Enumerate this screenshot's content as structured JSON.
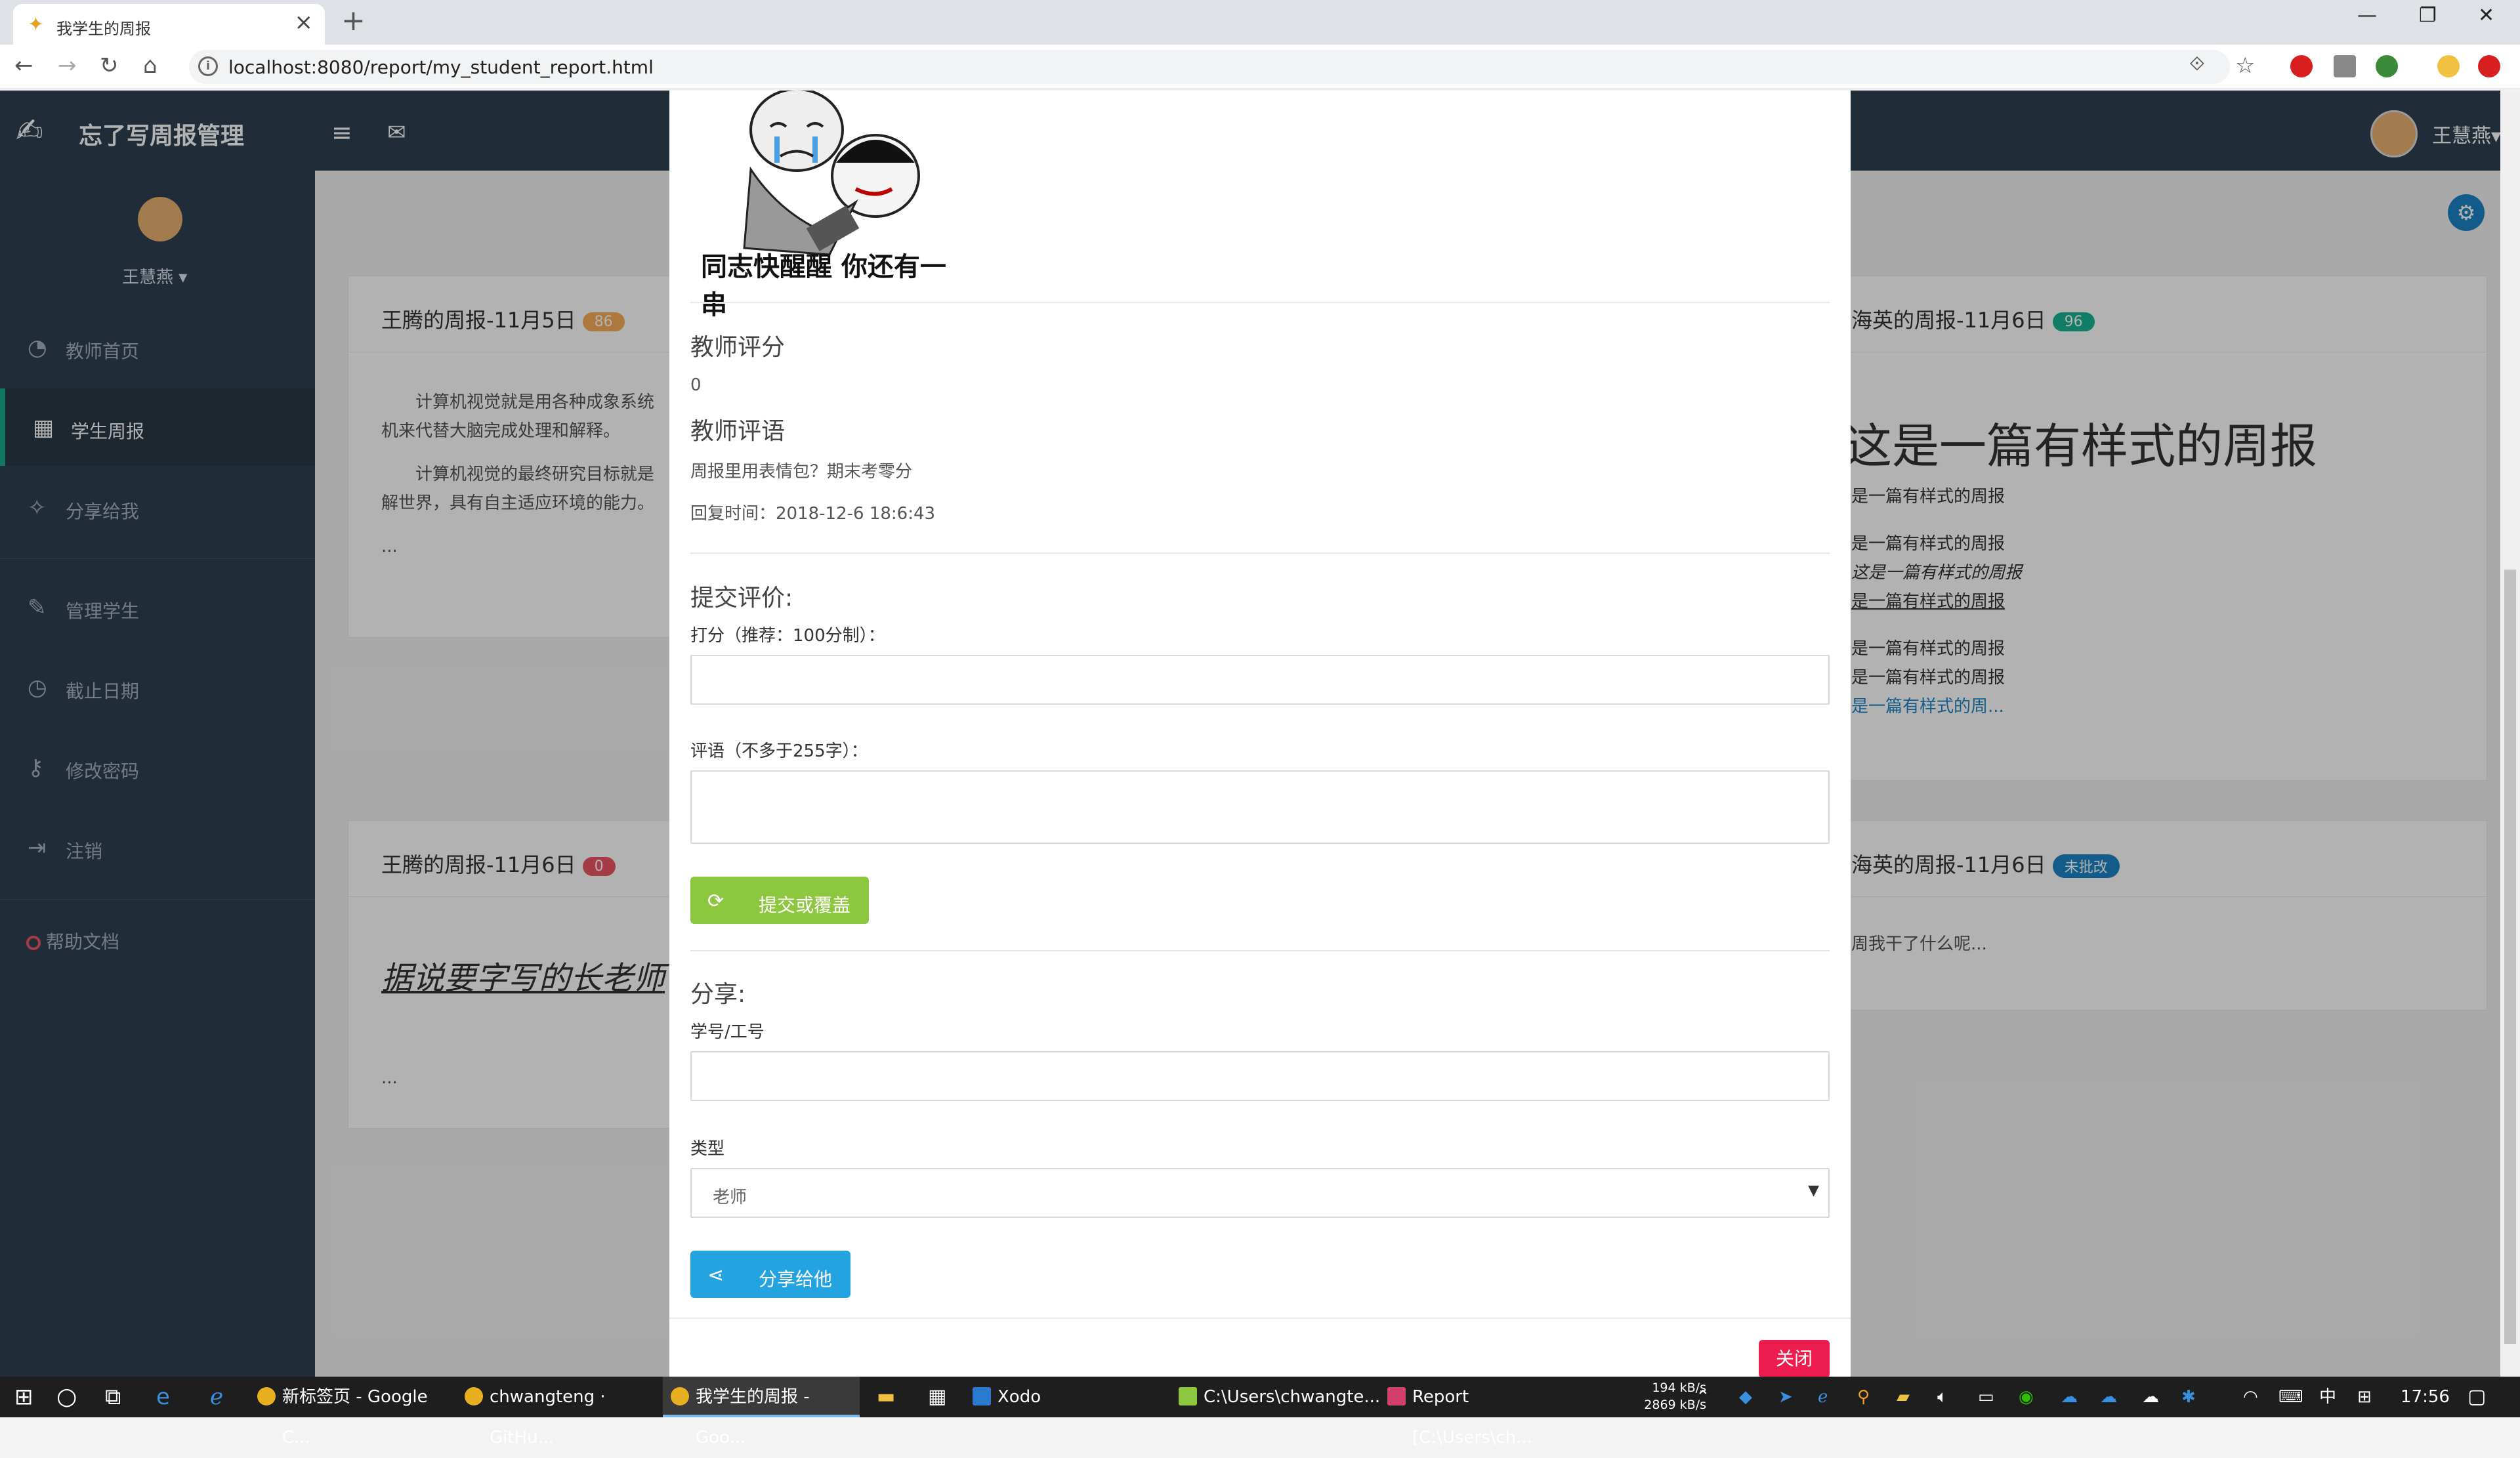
{
  "browser": {
    "tab_title": "我学生的周报",
    "url": "localhost:8080/report/my_student_report.html"
  },
  "app": {
    "brand": "忘了写周报管理",
    "user": "王慧燕",
    "sidebar": {
      "items": [
        {
          "label": "教师首页",
          "icon": "dashboard-icon"
        },
        {
          "label": "学生周报",
          "icon": "calendar-icon",
          "active": true
        },
        {
          "label": "分享给我",
          "icon": "share-icon"
        },
        {
          "label": "管理学生",
          "icon": "user-manage-icon"
        },
        {
          "label": "截止日期",
          "icon": "clock-icon"
        },
        {
          "label": "修改密码",
          "icon": "key-icon"
        },
        {
          "label": "注销",
          "icon": "logout-icon"
        }
      ],
      "help": "帮助文档"
    },
    "cards": [
      {
        "title": "王腾的周报-11月5日",
        "badge": "86",
        "badge_color": "#f8ac59",
        "lines": [
          "计算机视觉就是用各种成象系统",
          "机来代替大脑完成处理和解释。",
          "计算机视觉的最终研究目标就是",
          "解世界，具有自主适应环境的能力。",
          "..."
        ]
      },
      {
        "title": "海英的周报-11月6日",
        "badge": "96",
        "badge_color": "#1ab394",
        "heading": "这是一篇有样式的周报",
        "lines": [
          "是一篇有样式的周报",
          "是一篇有样式的周报",
          "这是一篇有样式的周报",
          "是一篇有样式的周报",
          "是一篇有样式的周报",
          "是一篇有样式的周报",
          "是一篇有样式的周..."
        ]
      },
      {
        "title": "王腾的周报-11月6日",
        "badge": "0",
        "badge_color": "#ed5565",
        "lines": [
          "据说要字写的长老师",
          "..."
        ]
      },
      {
        "title": "海英的周报-11月6日",
        "badge": "未批改",
        "badge_color": "#1c84c6",
        "lines": [
          "周我干了什么呢..."
        ]
      }
    ]
  },
  "modal": {
    "meme_caption": "同志快醒醒 你还有一串",
    "score_label": "教师评分",
    "score_value": "0",
    "comment_label": "教师评语",
    "comment_value": "周报里用表情包？期末考零分",
    "reply_time": "回复时间：2018-12-6 18:6:43",
    "submit_section": "提交评价:",
    "score_input_label": "打分（推荐：100分制）：",
    "comment_input_label": "评语（不多于255字）：",
    "submit_button": "提交或覆盖",
    "share_section": "分享:",
    "id_label": "学号/工号",
    "type_label": "类型",
    "type_selected": "老师",
    "share_button": "分享给他",
    "close_button": "关闭"
  },
  "taskbar": {
    "items": [
      "新标签页 - Google C...",
      "chwangteng · GitHu...",
      "我学生的周报 - Goo...",
      "Xodo",
      "C:\\Users\\chwangte...",
      "Report [C:\\Users\\ch..."
    ],
    "net_up": "194 kB/s",
    "net_down": "2869 kB/s",
    "ime": "中",
    "time": "17:56"
  }
}
